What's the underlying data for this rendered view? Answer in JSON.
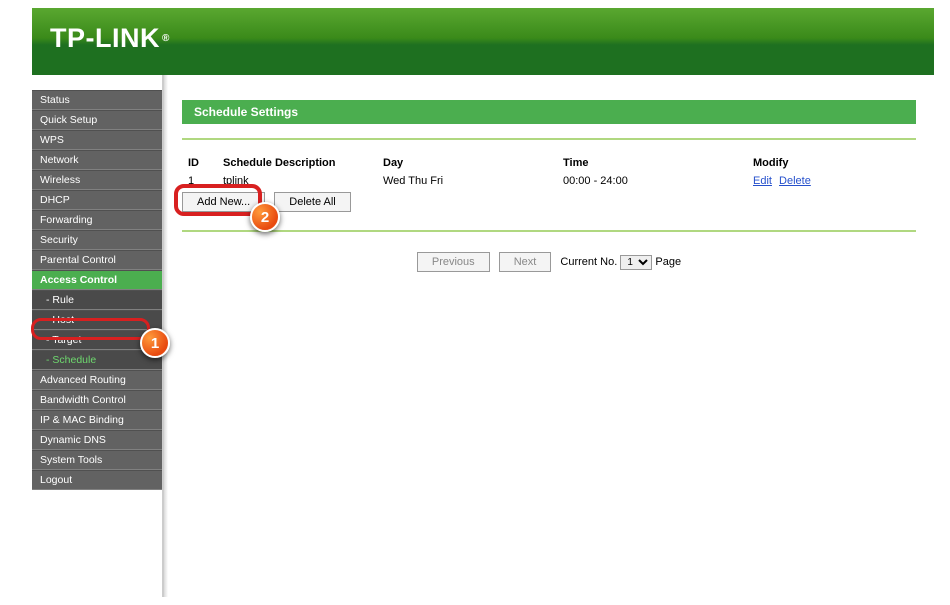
{
  "brand": "TP-LINK",
  "sidebar": {
    "items": [
      {
        "label": "Status",
        "t": "top"
      },
      {
        "label": "Quick Setup",
        "t": "top"
      },
      {
        "label": "WPS",
        "t": "top"
      },
      {
        "label": "Network",
        "t": "top"
      },
      {
        "label": "Wireless",
        "t": "top"
      },
      {
        "label": "DHCP",
        "t": "top"
      },
      {
        "label": "Forwarding",
        "t": "top"
      },
      {
        "label": "Security",
        "t": "top"
      },
      {
        "label": "Parental Control",
        "t": "top"
      },
      {
        "label": "Access Control",
        "t": "active"
      },
      {
        "label": "- Rule",
        "t": "sub"
      },
      {
        "label": "- Host",
        "t": "sub"
      },
      {
        "label": "- Target",
        "t": "sub"
      },
      {
        "label": "- Schedule",
        "t": "sub sel"
      },
      {
        "label": "Advanced Routing",
        "t": "top"
      },
      {
        "label": "Bandwidth Control",
        "t": "top"
      },
      {
        "label": "IP & MAC Binding",
        "t": "top"
      },
      {
        "label": "Dynamic DNS",
        "t": "top"
      },
      {
        "label": "System Tools",
        "t": "top"
      },
      {
        "label": "Logout",
        "t": "top"
      }
    ]
  },
  "panel": {
    "title": "Schedule Settings"
  },
  "table": {
    "headers": {
      "id": "ID",
      "desc": "Schedule Description",
      "day": "Day",
      "time": "Time",
      "modify": "Modify"
    },
    "rows": [
      {
        "id": "1",
        "desc": "tplink",
        "day": "Wed Thu Fri",
        "time": "00:00 - 24:00",
        "edit": "Edit",
        "delete": "Delete"
      }
    ]
  },
  "buttons": {
    "add_new": "Add New...",
    "delete_all": "Delete All",
    "previous": "Previous",
    "next": "Next"
  },
  "pager": {
    "label_before": "Current No.",
    "page": "1",
    "label_after": "Page"
  },
  "callouts": {
    "one": "1",
    "two": "2"
  }
}
